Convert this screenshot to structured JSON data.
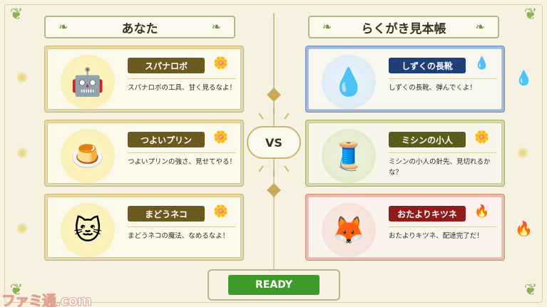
{
  "left_panel": {
    "title": "あなた",
    "cards": [
      {
        "name": "スパナロボ",
        "desc": "スパナロボの工具、甘く見るなよ！",
        "portrait": "robot-icon",
        "type_icon": "sun-icon"
      },
      {
        "name": "つよいプリン",
        "desc": "つよいプリンの強さ、見せてやる！",
        "portrait": "pudding-icon",
        "type_icon": "sun-icon"
      },
      {
        "name": "まどうネコ",
        "desc": "まどうネコの魔法、なめるなよ！",
        "portrait": "cat-wizard-icon",
        "type_icon": "sun-icon"
      }
    ]
  },
  "right_panel": {
    "title": "らくがき見本帳",
    "cards": [
      {
        "name": "しずくの長靴",
        "desc": "しずくの長靴、弾んでくよ！",
        "portrait": "droplet-icon",
        "type_icon": "water-drop-icon"
      },
      {
        "name": "ミシンの小人",
        "desc": "ミシンの小人の針先、見切れるかな？",
        "portrait": "sewing-machine-icon",
        "type_icon": "sun-icon"
      },
      {
        "name": "おたよりキツネ",
        "desc": "おたよりキツネ、配達完了だ！",
        "portrait": "fox-icon",
        "type_icon": "fire-icon"
      }
    ]
  },
  "vs_label": "VS",
  "ready_label": "READY",
  "watermark": "ファミ通.com",
  "colors": {
    "background": "#f6f1e1",
    "ready_green": "#3f9a2c",
    "player_tag": "#6b5a1f",
    "water_tag": "#1f3f79",
    "fire_tag": "#8f1c1c"
  }
}
